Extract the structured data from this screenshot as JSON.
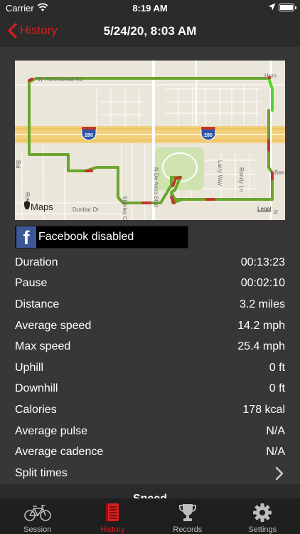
{
  "status_bar": {
    "carrier": "Carrier",
    "time": "8:19 AM",
    "icons": [
      "wifi-icon",
      "location-arrow-icon",
      "battery-icon"
    ]
  },
  "nav": {
    "back_label": "History",
    "title": "5/24/20, 8:03 AM",
    "accent_color": "#d81e1e"
  },
  "map": {
    "streets": [
      "W Homestead Rd",
      "280",
      "280",
      "N De Anza Blvd",
      "Larry Way",
      "Randy Ln",
      "Dunbar Dr",
      "Stanley Ct",
      "Bee",
      "Hom",
      "N",
      "Bai",
      "Rd"
    ],
    "attribution_logo": "Maps",
    "legal_label": "Legal",
    "route_colors": {
      "fast": "#6aa52d",
      "slow": "#c0362c"
    }
  },
  "facebook": {
    "logo_letter": "f",
    "label": "Facebook disabled"
  },
  "stats": [
    {
      "label": "Duration",
      "value": "00:13:23"
    },
    {
      "label": "Pause",
      "value": "00:02:10"
    },
    {
      "label": "Distance",
      "value": "3.2 miles"
    },
    {
      "label": "Average speed",
      "value": "14.2 mph"
    },
    {
      "label": "Max speed",
      "value": "25.4 mph"
    },
    {
      "label": "Uphill",
      "value": "0 ft"
    },
    {
      "label": "Downhill",
      "value": "0 ft"
    },
    {
      "label": "Calories",
      "value": "178 kcal"
    },
    {
      "label": "Average pulse",
      "value": "N/A"
    },
    {
      "label": "Average cadence",
      "value": "N/A"
    }
  ],
  "split_times": {
    "label": "Split times",
    "icon": "chevron-right-icon"
  },
  "peek_text": "Speed",
  "tabs": [
    {
      "label": "Session",
      "icon": "bicycle-icon",
      "active": false
    },
    {
      "label": "History",
      "icon": "logbook-icon",
      "active": true
    },
    {
      "label": "Records",
      "icon": "trophy-icon",
      "active": false
    },
    {
      "label": "Settings",
      "icon": "gear-icon",
      "active": false
    }
  ]
}
